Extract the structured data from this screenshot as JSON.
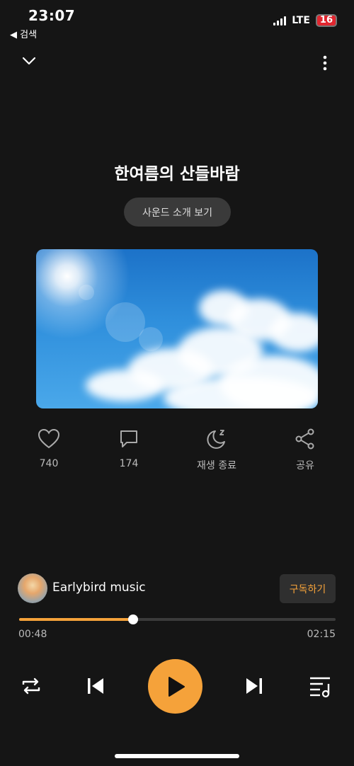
{
  "status": {
    "time": "23:07",
    "back_label": "◀ 검색",
    "network": "LTE",
    "battery": "16"
  },
  "sound": {
    "title": "한여름의 산들바람",
    "intro_button": "사운드 소개 보기"
  },
  "actions": [
    {
      "icon": "heart-icon",
      "label": "740"
    },
    {
      "icon": "comment-icon",
      "label": "174"
    },
    {
      "icon": "moon-icon",
      "label": "재생 종료"
    },
    {
      "icon": "share-icon",
      "label": "공유"
    }
  ],
  "artist": {
    "name": "Earlybird music",
    "subscribe_label": "구독하기"
  },
  "player": {
    "current_time": "00:48",
    "total_time": "02:15",
    "progress": 0.36,
    "accent_color": "#f5a23a"
  }
}
